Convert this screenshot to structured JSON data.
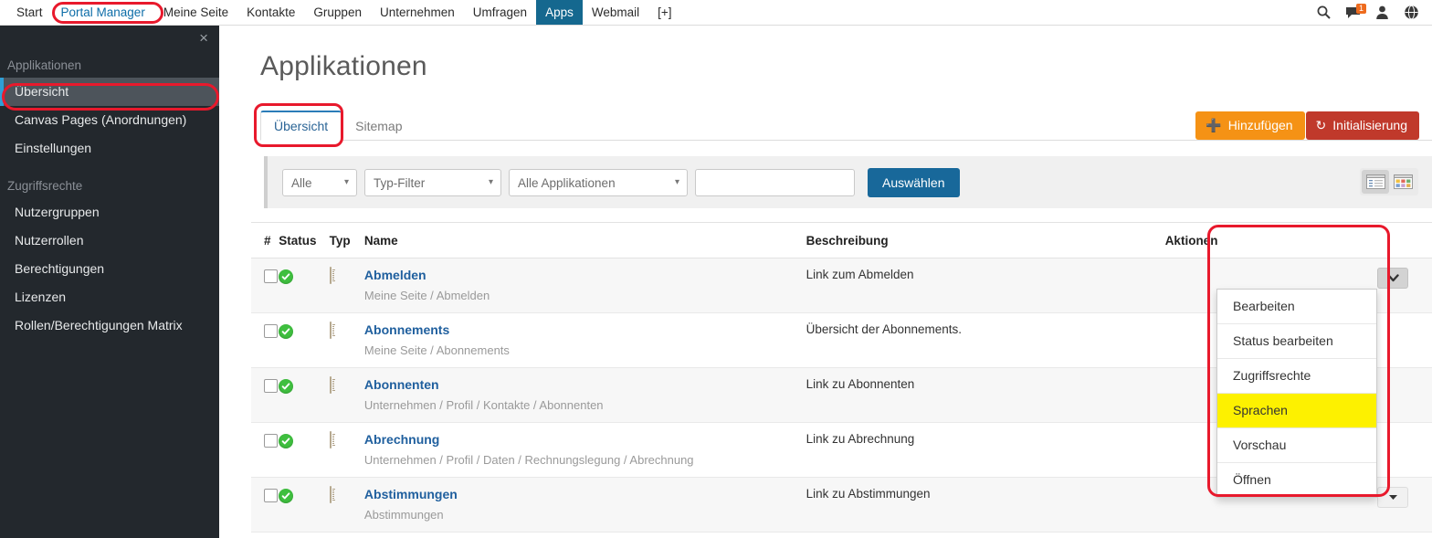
{
  "topnav": {
    "items": [
      {
        "label": "Start",
        "state": "normal"
      },
      {
        "label": "Portal Manager",
        "state": "highlighted"
      },
      {
        "label": "Meine Seite",
        "state": "normal"
      },
      {
        "label": "Kontakte",
        "state": "normal"
      },
      {
        "label": "Gruppen",
        "state": "normal"
      },
      {
        "label": "Unternehmen",
        "state": "normal"
      },
      {
        "label": "Umfragen",
        "state": "normal"
      },
      {
        "label": "Apps",
        "state": "active"
      },
      {
        "label": "Webmail",
        "state": "normal"
      },
      {
        "label": "[+]",
        "state": "normal"
      }
    ],
    "icons": [
      {
        "name": "search-icon"
      },
      {
        "name": "chat-icon",
        "badge": "1"
      },
      {
        "name": "user-icon"
      },
      {
        "name": "globe-icon"
      }
    ],
    "badge_color": "#ee6b1e",
    "active_color": "#15688f"
  },
  "sidebar": {
    "close_label": "×",
    "groups": [
      {
        "label": "Applikationen",
        "items": [
          {
            "label": "Übersicht",
            "active": true
          },
          {
            "label": "Canvas Pages (Anordnungen)",
            "active": false
          },
          {
            "label": "Einstellungen",
            "active": false
          }
        ]
      },
      {
        "label": "Zugriffsrechte",
        "items": [
          {
            "label": "Nutzergruppen",
            "active": false
          },
          {
            "label": "Nutzerrollen",
            "active": false
          },
          {
            "label": "Berechtigungen",
            "active": false
          },
          {
            "label": "Lizenzen",
            "active": false
          },
          {
            "label": "Rollen/Berechtigungen Matrix",
            "active": false
          }
        ]
      }
    ],
    "bg_color": "#23282d",
    "active_bg_color": "#4d545b"
  },
  "main": {
    "page_title": "Applikationen",
    "tabs": [
      {
        "label": "Übersicht",
        "active": true
      },
      {
        "label": "Sitemap",
        "active": false
      }
    ],
    "buttons": {
      "add_label": "Hinzufügen",
      "add_icon": "plus-icon",
      "add_color": "#f59215",
      "init_label": "Initialisierung",
      "init_icon": "refresh-icon",
      "init_color": "#c0392b"
    }
  },
  "filters": {
    "select_all": "Alle",
    "select_type": "Typ-Filter",
    "select_apps": "Alle Applikationen",
    "search_value": "",
    "search_placeholder": "",
    "submit_label": "Auswählen",
    "view_list_icon": "list-view-icon",
    "view_grid_icon": "grid-view-icon"
  },
  "table": {
    "headers": {
      "num": "#",
      "status": "Status",
      "typ": "Typ",
      "name": "Name",
      "desc": "Beschreibung",
      "actions": "Aktionen"
    },
    "rows": [
      {
        "name": "Abmelden",
        "path": "Meine Seite / Abmelden",
        "desc": "Link zum Abmelden",
        "status": "ok",
        "typ": "page-icon"
      },
      {
        "name": "Abonnements",
        "path": "Meine Seite / Abonnements",
        "desc": "Übersicht der Abonnements.",
        "status": "ok",
        "typ": "page-icon"
      },
      {
        "name": "Abonnenten",
        "path": "Unternehmen / Profil / Kontakte / Abonnenten",
        "desc": "Link zu Abonnenten",
        "status": "ok",
        "typ": "page-icon"
      },
      {
        "name": "Abrechnung",
        "path": "Unternehmen / Profil / Daten / Rechnungslegung / Abrechnung",
        "desc": "Link zu Abrechnung",
        "status": "ok",
        "typ": "page-icon"
      },
      {
        "name": "Abstimmungen",
        "path": "Abstimmungen",
        "desc": "Link zu Abstimmungen",
        "status": "ok",
        "typ": "page-icon"
      }
    ]
  },
  "dropdown": {
    "items": [
      {
        "label": "Bearbeiten",
        "highlighted": false
      },
      {
        "label": "Status bearbeiten",
        "highlighted": false
      },
      {
        "label": "Zugriffsrechte",
        "highlighted": false
      },
      {
        "label": "Sprachen",
        "highlighted": true
      },
      {
        "label": "Vorschau",
        "highlighted": false
      },
      {
        "label": "Öffnen",
        "highlighted": false
      }
    ],
    "highlight_color": "#fdf100"
  },
  "annotations": {
    "color": "#e8192c"
  }
}
